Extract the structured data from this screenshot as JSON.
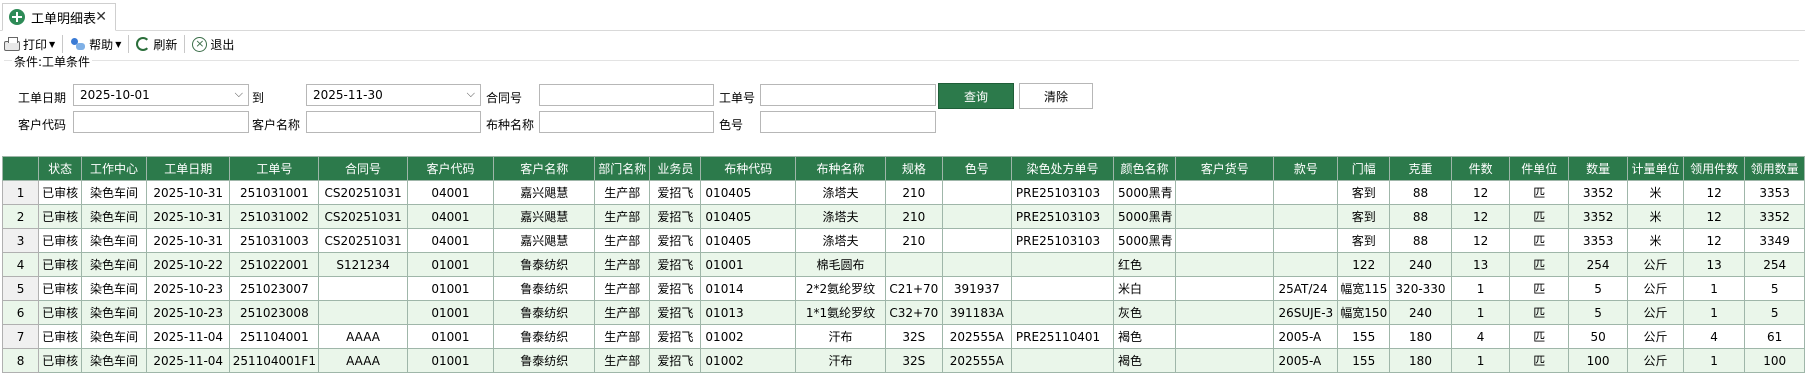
{
  "tab": {
    "title": "工单明细表",
    "close": "✕"
  },
  "toolbar": {
    "print": "打印",
    "help": "帮助",
    "refresh": "刷新",
    "exit": "退出",
    "caret": "▼"
  },
  "filter": {
    "legend": "条件:工单条件",
    "order_date_label": "工单日期",
    "date_from": "2025-10-01",
    "to_label": "到",
    "date_to": "2025-11-30",
    "contract_label": "合同号",
    "contract_value": "",
    "order_no_label": "工单号",
    "order_no_value": "",
    "customer_code_label": "客户代码",
    "customer_code_value": "",
    "customer_name_label": "客户名称",
    "customer_name_value": "",
    "fabric_name_label": "布种名称",
    "fabric_name_value": "",
    "color_no_label": "色号",
    "color_no_value": "",
    "query_button": "查询",
    "clear_button": "清除",
    "select_arrow": "⌵"
  },
  "colors": {
    "header_bg": "#2c7a4b",
    "alt_row_bg": "#eaf6ea",
    "query_button_bg": "#2c7a4b"
  },
  "table": {
    "columns": [
      "",
      "状态",
      "工作中心",
      "工单日期",
      "工单号",
      "合同号",
      "客户代码",
      "客户名称",
      "部门名称",
      "业务员",
      "布种代码",
      "布种名称",
      "规格",
      "色号",
      "染色处方单号",
      "颜色名称",
      "客户货号",
      "款号",
      "门幅",
      "克重",
      "件数",
      "件单位",
      "数量",
      "计量单位",
      "领用件数",
      "领用数量"
    ],
    "rows": [
      [
        "1",
        "已审核",
        "染色车间",
        "2025-10-31",
        "251031001",
        "CS20251031",
        "04001",
        "嘉兴飓慧",
        "生产部",
        "爱招飞",
        "010405",
        "涤塔夫",
        "210",
        "",
        "PRE25103103",
        "5000黑青",
        "",
        "",
        "客到",
        "88",
        "12",
        "匹",
        "3352",
        "米",
        "12",
        "3353"
      ],
      [
        "2",
        "已审核",
        "染色车间",
        "2025-10-31",
        "251031002",
        "CS20251031",
        "04001",
        "嘉兴飓慧",
        "生产部",
        "爱招飞",
        "010405",
        "涤塔夫",
        "210",
        "",
        "PRE25103103",
        "5000黑青",
        "",
        "",
        "客到",
        "88",
        "12",
        "匹",
        "3352",
        "米",
        "12",
        "3352"
      ],
      [
        "3",
        "已审核",
        "染色车间",
        "2025-10-31",
        "251031003",
        "CS20251031",
        "04001",
        "嘉兴飓慧",
        "生产部",
        "爱招飞",
        "010405",
        "涤塔夫",
        "210",
        "",
        "PRE25103103",
        "5000黑青",
        "",
        "",
        "客到",
        "88",
        "12",
        "匹",
        "3353",
        "米",
        "12",
        "3349"
      ],
      [
        "4",
        "已审核",
        "染色车间",
        "2025-10-22",
        "251022001",
        "S121234",
        "01001",
        "鲁泰纺织",
        "生产部",
        "爱招飞",
        "01001",
        "棉毛圆布",
        "",
        "",
        "",
        "红色",
        "",
        "",
        "122",
        "240",
        "13",
        "匹",
        "254",
        "公斤",
        "13",
        "254"
      ],
      [
        "5",
        "已审核",
        "染色车间",
        "2025-10-23",
        "251023007",
        "",
        "01001",
        "鲁泰纺织",
        "生产部",
        "爱招飞",
        "01014",
        "2*2氨纶罗纹",
        "C21+70",
        "391937",
        "",
        "米白",
        "",
        "25AT/24",
        "幅宽115",
        "320-330",
        "1",
        "匹",
        "5",
        "公斤",
        "1",
        "5"
      ],
      [
        "6",
        "已审核",
        "染色车间",
        "2025-10-23",
        "251023008",
        "",
        "01001",
        "鲁泰纺织",
        "生产部",
        "爱招飞",
        "01013",
        "1*1氨纶罗纹",
        "C32+70",
        "391183A",
        "",
        "灰色",
        "",
        "26SUJE-3",
        "幅宽150",
        "240",
        "1",
        "匹",
        "5",
        "公斤",
        "1",
        "5"
      ],
      [
        "7",
        "已审核",
        "染色车间",
        "2025-11-04",
        "251104001",
        "AAAA",
        "01001",
        "鲁泰纺织",
        "生产部",
        "爱招飞",
        "01002",
        "汗布",
        "32S",
        "202555A",
        "PRE25110401",
        "褐色",
        "",
        "2005-A",
        "155",
        "180",
        "4",
        "匹",
        "50",
        "公斤",
        "4",
        "61"
      ],
      [
        "8",
        "已审核",
        "染色车间",
        "2025-11-04",
        "251104001F1",
        "AAAA",
        "01001",
        "鲁泰纺织",
        "生产部",
        "爱招飞",
        "01002",
        "汗布",
        "32S",
        "202555A",
        "",
        "褐色",
        "",
        "2005-A",
        "155",
        "180",
        "1",
        "匹",
        "100",
        "公斤",
        "1",
        "100"
      ]
    ]
  }
}
